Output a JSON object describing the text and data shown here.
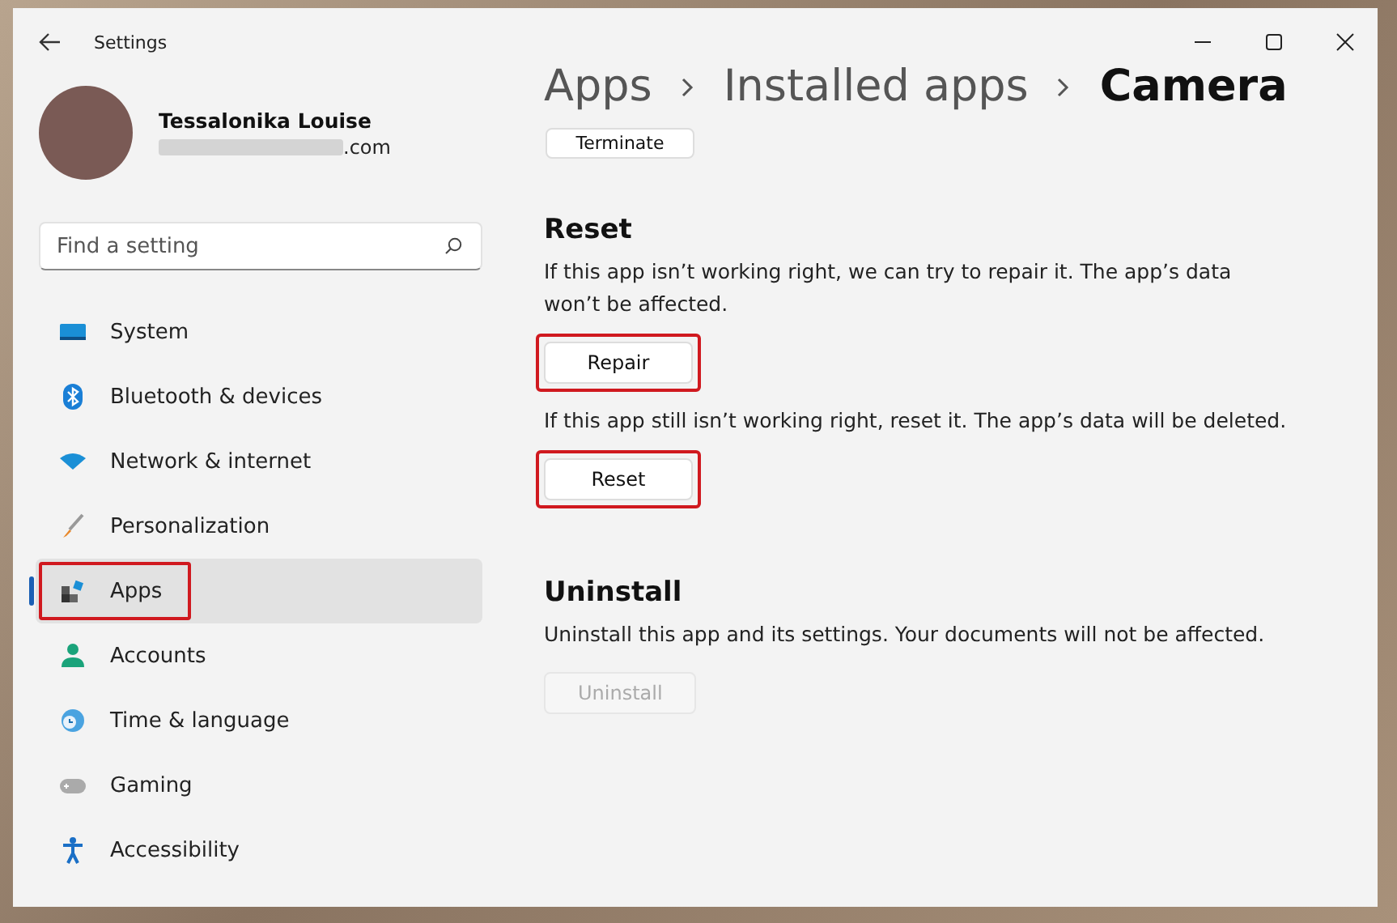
{
  "window": {
    "title": "Settings"
  },
  "account": {
    "name": "Tessalonika Louise",
    "email": ".com"
  },
  "search": {
    "placeholder": "Find a setting"
  },
  "sidebar": {
    "items": [
      {
        "label": "System",
        "kind": "system",
        "selected": false,
        "highlighted": false
      },
      {
        "label": "Bluetooth & devices",
        "kind": "bluetooth",
        "selected": false,
        "highlighted": false
      },
      {
        "label": "Network & internet",
        "kind": "network",
        "selected": false,
        "highlighted": false
      },
      {
        "label": "Personalization",
        "kind": "brush",
        "selected": false,
        "highlighted": false
      },
      {
        "label": "Apps",
        "kind": "apps",
        "selected": true,
        "highlighted": true
      },
      {
        "label": "Accounts",
        "kind": "person",
        "selected": false,
        "highlighted": false
      },
      {
        "label": "Time & language",
        "kind": "clock",
        "selected": false,
        "highlighted": false
      },
      {
        "label": "Gaming",
        "kind": "gamepad",
        "selected": false,
        "highlighted": false
      },
      {
        "label": "Accessibility",
        "kind": "accessibility",
        "selected": false,
        "highlighted": false
      }
    ]
  },
  "breadcrumb": [
    {
      "label": "Apps",
      "current": false
    },
    {
      "label": "Installed apps",
      "current": false
    },
    {
      "label": "Camera",
      "current": true
    }
  ],
  "top_button": {
    "label": "Terminate",
    "disabled": false
  },
  "sections": [
    {
      "title": "Reset",
      "blocks": [
        {
          "text": "If this app isn’t working right, we can try to repair it. The app’s data won’t be affected.",
          "button": {
            "label": "Repair",
            "disabled": false,
            "highlighted": true
          }
        },
        {
          "text": "If this app still isn’t working right, reset it. The app’s data will be deleted.",
          "button": {
            "label": "Reset",
            "disabled": false,
            "highlighted": true
          }
        }
      ]
    },
    {
      "title": "Uninstall",
      "blocks": [
        {
          "text": "Uninstall this app and its settings. Your documents will not be affected.",
          "button": {
            "label": "Uninstall",
            "disabled": true,
            "highlighted": false
          }
        }
      ]
    }
  ]
}
